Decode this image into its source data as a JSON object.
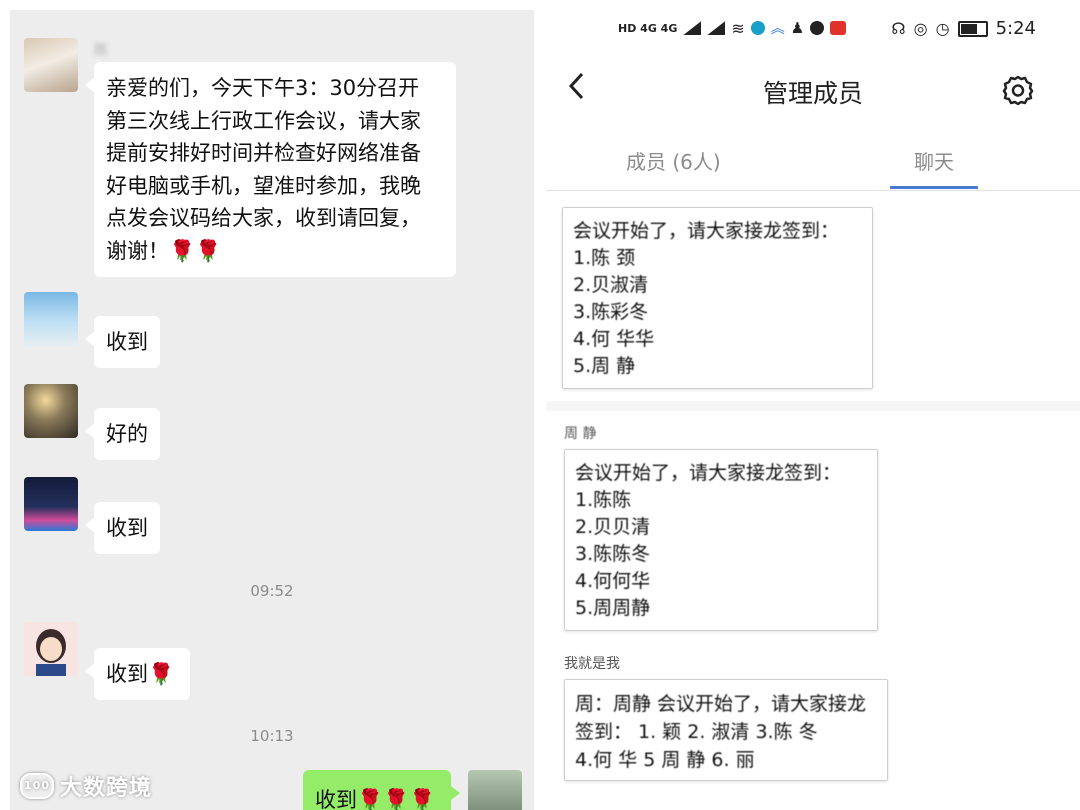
{
  "left_chat": {
    "messages": [
      {
        "sender": "陈",
        "text_lines": [
          "亲爱的们，今天下午3：30分召开",
          "第三次线上行政工作会议，请大家",
          "提前安排好时间并检查好网络准备",
          "好电脑或手机，望准时参加，我晚",
          "点发会议码给大家，收到请回复，",
          "谢谢！🌹🌹"
        ]
      },
      {
        "sender": "",
        "text": "收到"
      },
      {
        "sender": "",
        "text": "好的"
      },
      {
        "sender": "",
        "text": "收到"
      },
      {
        "sender": "",
        "text": "收到🌹"
      }
    ],
    "time_1": "09:52",
    "time_2": "10:13",
    "my_message": "收到🌹🌹🌹",
    "watermark": "大数跨境",
    "watermark_logo": "100"
  },
  "right_panel": {
    "status_bar": {
      "left_indicators": "HD 4G 4G",
      "time": "5:24"
    },
    "header": {
      "back_symbol": "‹",
      "title": "管理成员"
    },
    "tabs": [
      {
        "label": "成员 (6人)"
      },
      {
        "label": "聊天"
      }
    ],
    "cards": [
      {
        "author": "",
        "lines": [
          "会议开始了，请大家接龙签到：",
          "1.陈 颈",
          "2.贝淑清",
          "3.陈彩冬",
          "4.何 华华",
          "5.周 静"
        ]
      },
      {
        "author": "周 静",
        "lines": [
          "会议开始了，请大家接龙签到：",
          "1.陈陈",
          "2.贝贝清",
          "3.陈陈冬",
          "4.何何华",
          "5.周周静"
        ]
      },
      {
        "author": "我就是我",
        "lines": [
          "周：周静 会议开始了，请大家接龙",
          "签到： 1. 颖 2. 淑清 3.陈 冬",
          "4.何 华 5 周 静 6. 丽"
        ]
      }
    ]
  },
  "colors": {
    "chat_bg": "#ededed",
    "my_bubble": "#95ec69",
    "tab_accent": "#4a7bd0",
    "rose": "#d23b3b"
  }
}
